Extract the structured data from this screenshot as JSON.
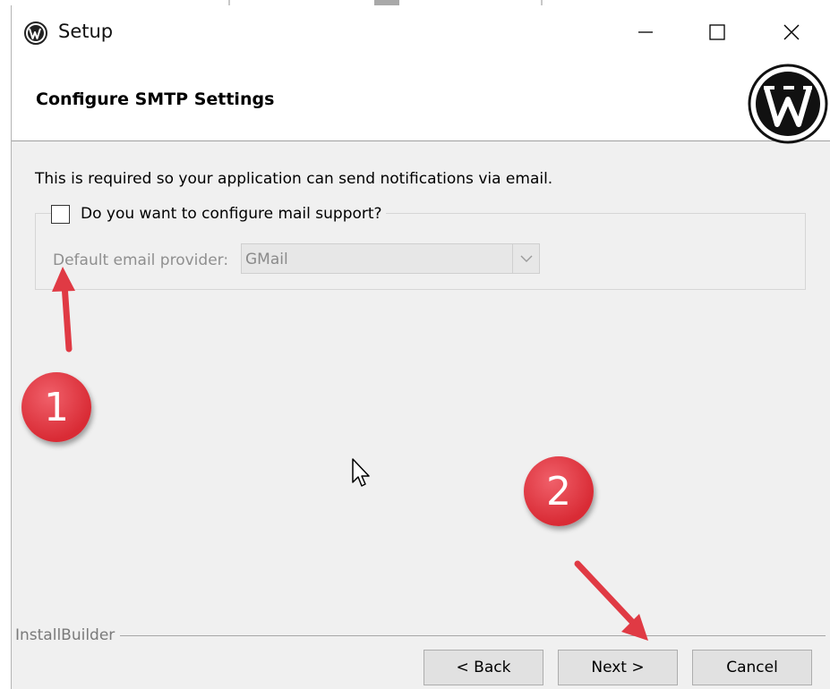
{
  "window": {
    "title": "Setup",
    "icon": "wordpress-icon",
    "controls": {
      "minimize": "minimize-icon",
      "maximize": "maximize-icon",
      "close": "close-icon"
    }
  },
  "header": {
    "title": "Configure SMTP Settings",
    "logo": "wordpress-logo"
  },
  "body": {
    "description": "This is required so your application can send notifications via email.",
    "mail_support_checkbox": {
      "label": "Do you want to configure mail support?",
      "checked": false
    },
    "provider": {
      "label": "Default email provider:",
      "value": "GMail",
      "enabled": false
    }
  },
  "footer": {
    "brand": "InstallBuilder",
    "buttons": {
      "back": "< Back",
      "next": "Next >",
      "cancel": "Cancel"
    }
  },
  "annotations": {
    "step1": "1",
    "step2": "2",
    "color": "#e03a44"
  }
}
